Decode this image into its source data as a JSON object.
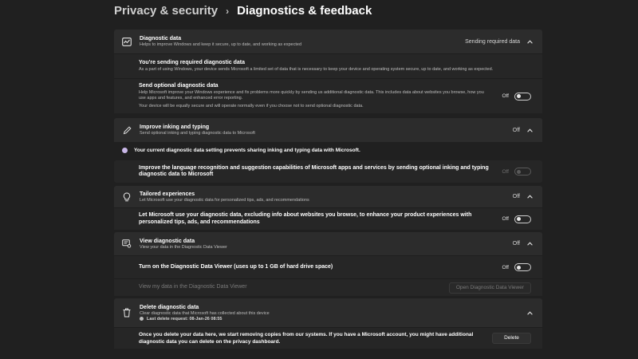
{
  "breadcrumb": {
    "parent": "Privacy & security",
    "separator": "›",
    "current": "Diagnostics & feedback"
  },
  "diagnostic_data": {
    "icon": "diagnostic-chart-icon",
    "title": "Diagnostic data",
    "description": "Helps to improve Windows and keep it secure, up to date, and working as expected",
    "status": "Sending required data",
    "expanded": true,
    "required": {
      "title": "You're sending required diagnostic data",
      "description": "As a part of using Windows, your device sends Microsoft a limited set of data that is necessary to keep your device and operating system secure, up to date, and working as expected."
    },
    "optional": {
      "title": "Send optional diagnostic data",
      "description": "Help Microsoft improve your Windows experience and fix problems more quickly by sending us additional diagnostic data. This includes data about websites you browse, how you use apps and features, and enhanced error reporting.",
      "note": "Your device will be equally secure and will operate normally even if you choose not to send optional diagnostic data.",
      "toggle_label": "Off",
      "toggle_on": false
    }
  },
  "inking": {
    "icon": "pen-icon",
    "title": "Improve inking and typing",
    "description": "Send optional inking and typing diagnostic data to Microsoft",
    "status": "Off",
    "notice": "Your current diagnostic data setting prevents sharing inking and typing data with Microsoft.",
    "option": {
      "title": "Improve the language recognition and suggestion capabilities of Microsoft apps and services by sending optional inking and typing diagnostic data to Microsoft",
      "toggle_label": "Off",
      "toggle_on": false,
      "disabled": true
    }
  },
  "tailored": {
    "icon": "lightbulb-icon",
    "title": "Tailored experiences",
    "description": "Let Microsoft use your diagnostic data for personalized tips, ads, and recommendations",
    "status": "Off",
    "option": {
      "title": "Let Microsoft use your diagnostic data, excluding info about websites you browse, to enhance your product experiences with personalized tips, ads, and recommendations",
      "toggle_label": "Off",
      "toggle_on": false
    }
  },
  "viewer": {
    "icon": "data-viewer-icon",
    "title": "View diagnostic data",
    "description": "View your data in the Diagnostic Data Viewer",
    "status": "Off",
    "option": {
      "title": "Turn on the Diagnostic Data Viewer (uses up to 1 GB of hard drive space)",
      "toggle_label": "Off",
      "toggle_on": false
    },
    "view_row": {
      "label": "View my data in the Diagnostic Data Viewer",
      "button": "Open Diagnostic Data Viewer"
    }
  },
  "delete": {
    "icon": "trash-icon",
    "title": "Delete diagnostic data",
    "description": "Clear diagnostic data that Microsoft has collected about this device",
    "last_request": "Last delete request: 08-Jan-26 08:55",
    "body": "Once you delete your data here, we start removing copies from our systems. If you have a Microsoft account, you might have additional diagnostic data you can delete on the privacy dashboard.",
    "button": "Delete"
  },
  "colors": {
    "background": "#202020",
    "card_header": "#2c2c2c",
    "card_row": "#262626",
    "notice_dot": "#c9b7e8"
  }
}
